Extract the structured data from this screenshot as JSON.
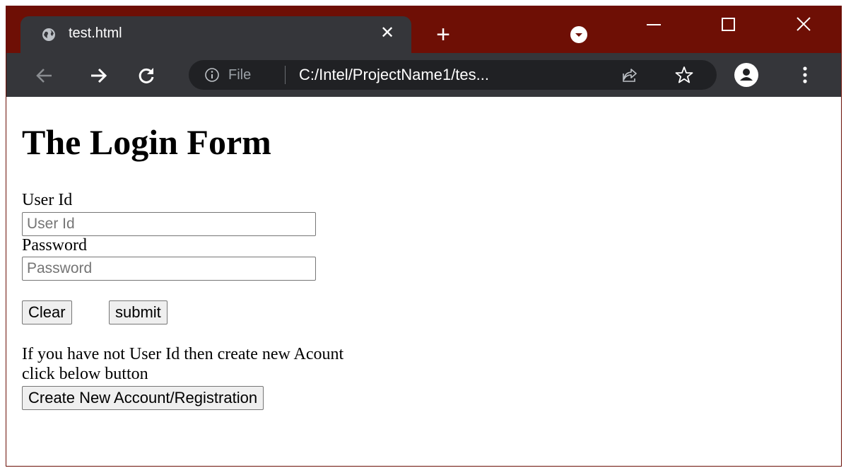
{
  "browser": {
    "tab_title": "test.html",
    "address": {
      "scheme_label": "File",
      "url": "C:/Intel/ProjectName1/tes..."
    },
    "icons": {
      "tab_favicon": "globe-icon",
      "tab_close": "close-icon",
      "new_tab": "plus-icon",
      "tab_search": "chevron-down-circle-icon",
      "minimize": "minimize-icon",
      "maximize": "maximize-icon",
      "close_window": "close-icon",
      "back": "arrow-left-icon",
      "forward": "arrow-right-icon",
      "reload": "reload-icon",
      "site_info": "info-icon",
      "share": "share-icon",
      "bookmark": "star-icon",
      "profile": "profile-icon",
      "menu": "kebab-menu-icon"
    },
    "colors": {
      "titlebar": "#6e0f05",
      "toolbar": "#35363a",
      "omnibox": "#202124"
    }
  },
  "page": {
    "heading": "The Login Form",
    "user_id_label": "User Id",
    "user_id_placeholder": "User Id",
    "user_id_value": "",
    "password_label": "Password",
    "password_placeholder": "Password",
    "password_value": "",
    "clear_button": "Clear",
    "submit_button": "submit",
    "info_line1": "If you have not User Id then create new Acount",
    "info_line2": "click below button",
    "create_account_button": "Create New Account/Registration"
  }
}
